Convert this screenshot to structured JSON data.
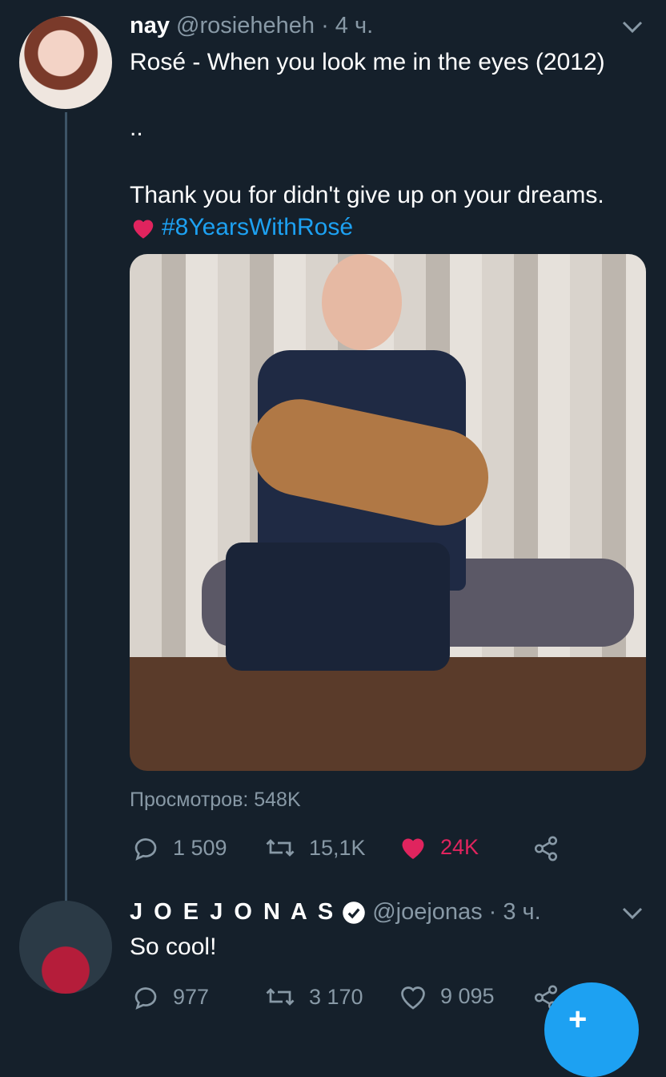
{
  "tweet1": {
    "name": "nay",
    "handle": "@rosieheheh",
    "separator": "·",
    "time": "4 ч.",
    "line1": "Rosé - When you look me in the eyes (2012)",
    "line2": "..",
    "line3": "Thank you for didn't give up on your dreams.",
    "hashtag": "#8YearsWithRosé",
    "views": "Просмотров: 548K",
    "replies": "1 509",
    "retweets": "15,1K",
    "likes": "24K"
  },
  "tweet2": {
    "name": "J O E  J O N A S",
    "handle": "@joejonas",
    "separator": "·",
    "time": "3 ч.",
    "text": "So cool!",
    "replies": "977",
    "retweets": "3 170",
    "likes": "9 095"
  },
  "fab": {
    "label": "+"
  },
  "colors": {
    "background": "#15202b",
    "accent": "#1da1f2",
    "like": "#e0245e",
    "muted": "#8899a6"
  },
  "icons": [
    "chevron-down-icon",
    "heart-icon",
    "reply-icon",
    "retweet-icon",
    "share-icon",
    "verified-icon",
    "compose-icon"
  ]
}
